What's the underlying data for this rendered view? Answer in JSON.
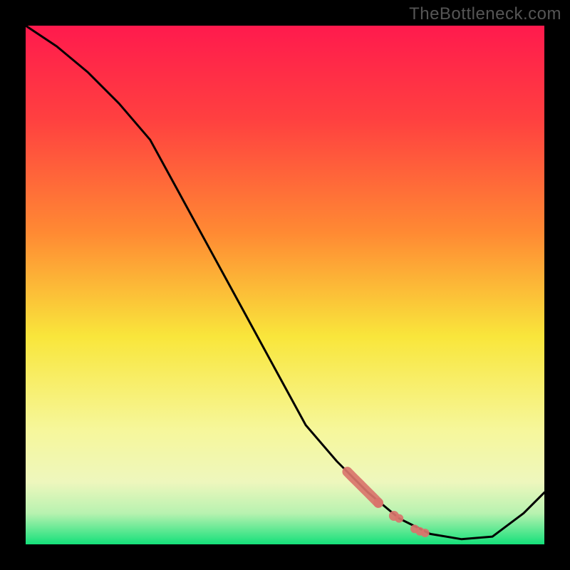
{
  "watermark": "TheBottleneck.com",
  "colors": {
    "frame": "#000000",
    "curve": "#000000",
    "markers": "#d9746b",
    "gradient_top": "#ff1a4d",
    "gradient_mid1": "#ff8a33",
    "gradient_mid2": "#f9e63b",
    "gradient_mid3": "#f6f79b",
    "gradient_bottom": "#14e07a"
  },
  "chart_data": {
    "type": "line",
    "title": "",
    "xlabel": "",
    "ylabel": "",
    "xlim": [
      0,
      100
    ],
    "ylim": [
      0,
      100
    ],
    "grid": false,
    "series": [
      {
        "name": "curve",
        "x": [
          0,
          6,
          12,
          18,
          24,
          30,
          36,
          42,
          48,
          54,
          60,
          66,
          72,
          78,
          84,
          90,
          96,
          100
        ],
        "y": [
          100,
          96,
          91,
          85,
          78,
          67,
          56,
          45,
          34,
          23,
          16,
          10,
          5,
          2,
          1,
          1.5,
          6,
          10
        ]
      }
    ],
    "markers": {
      "name": "highlighted-segment",
      "x": [
        62,
        63,
        64,
        65,
        66,
        67,
        68,
        71,
        72,
        75,
        76,
        77
      ],
      "y": [
        14,
        13,
        12,
        11,
        10,
        9,
        8,
        5.5,
        5,
        3,
        2.5,
        2.2
      ]
    }
  }
}
